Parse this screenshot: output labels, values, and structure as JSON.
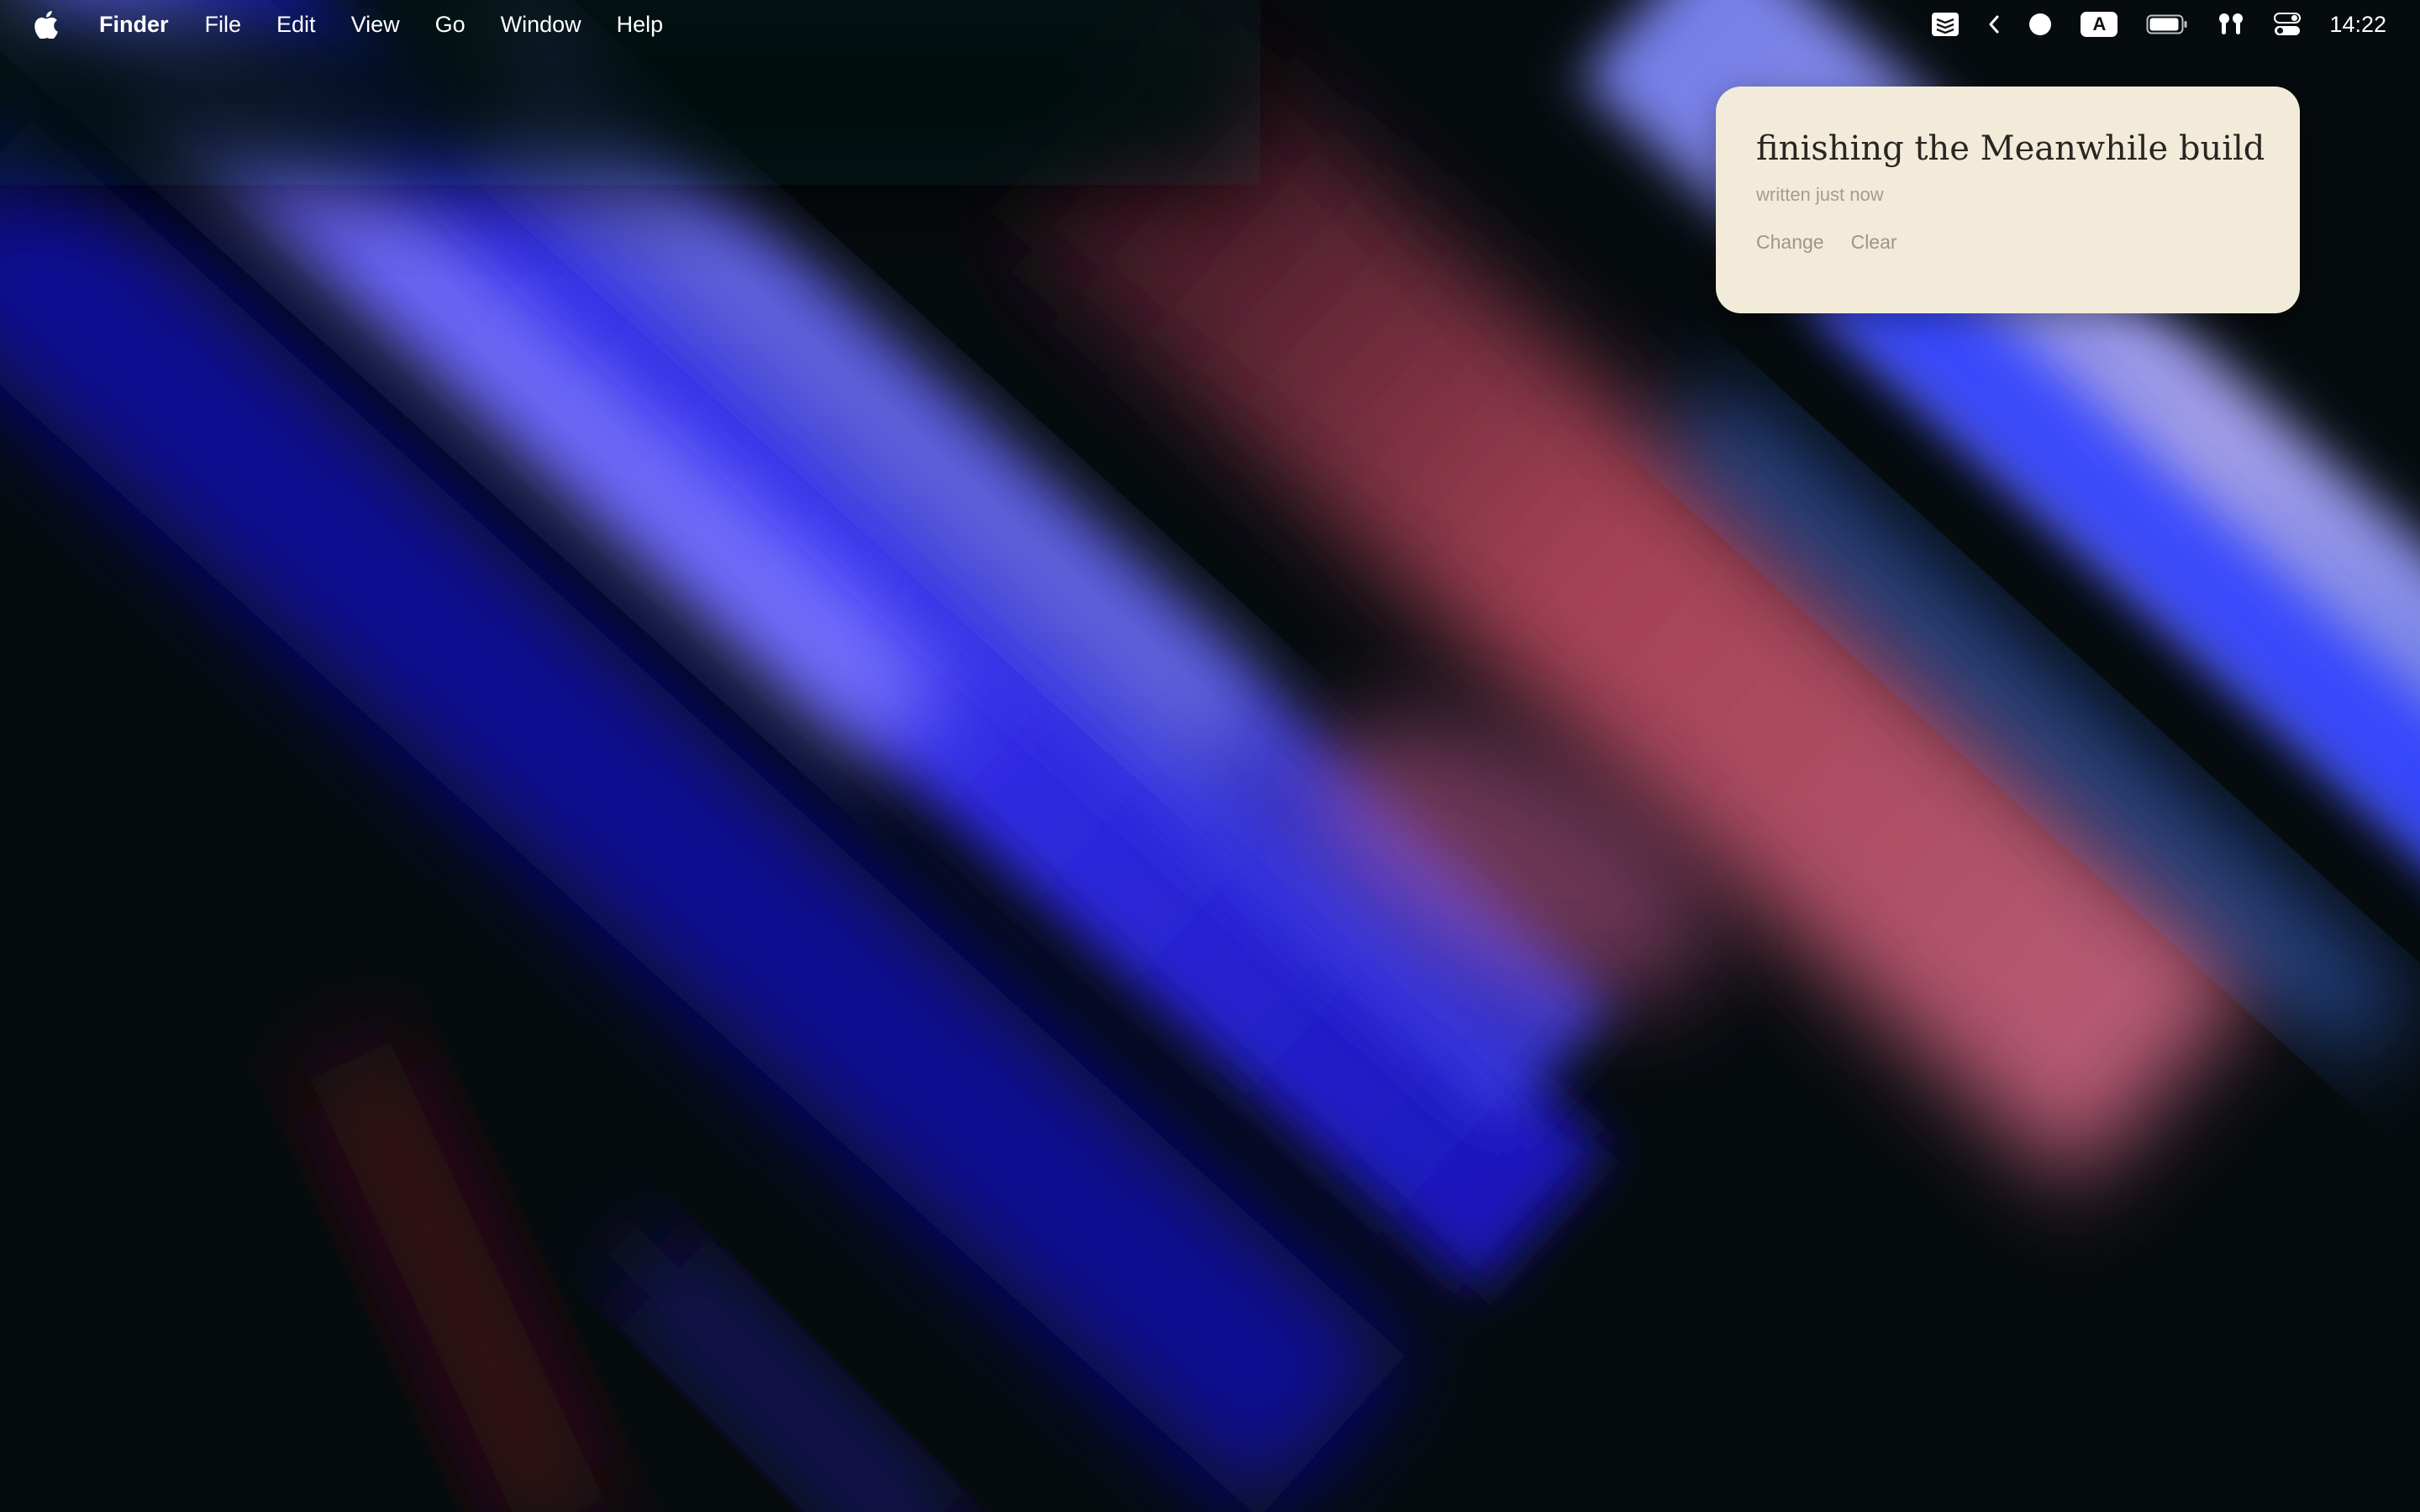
{
  "menubar": {
    "app_name": "Finder",
    "menus": [
      "File",
      "Edit",
      "View",
      "Go",
      "Window",
      "Help"
    ],
    "status": {
      "input_source": "A",
      "clock": "14:22"
    },
    "icons": [
      "apple-logo-icon",
      "stack-app-icon",
      "chevron-left-icon",
      "record-dot-icon",
      "input-source-icon",
      "battery-icon",
      "airpods-icon",
      "control-center-icon"
    ]
  },
  "note": {
    "title": "finishing the Meanwhile build",
    "meta": "written just now",
    "actions": {
      "change": "Change",
      "clear": "Clear"
    },
    "background_color": "#f3ebda"
  },
  "wallpaper": {
    "colors": [
      "#060b0e",
      "#1a1cf0",
      "#8a8cff",
      "#c2445f",
      "#b8b0ff",
      "#4a8cff"
    ]
  }
}
